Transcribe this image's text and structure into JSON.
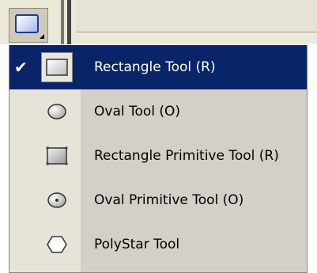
{
  "toolbar": {
    "active_tool_icon": "rectangle-tool-icon"
  },
  "menu": {
    "items": [
      {
        "label": "Rectangle Tool (R)",
        "icon": "rectangle-icon",
        "checked": true
      },
      {
        "label": "Oval Tool (O)",
        "icon": "oval-icon",
        "checked": false
      },
      {
        "label": "Rectangle Primitive Tool (R)",
        "icon": "rectangle-primitive-icon",
        "checked": false
      },
      {
        "label": "Oval Primitive Tool (O)",
        "icon": "oval-primitive-icon",
        "checked": false
      },
      {
        "label": "PolyStar Tool",
        "icon": "polystar-icon",
        "checked": false
      }
    ],
    "check_glyph": "✔"
  },
  "colors": {
    "selection": "#0a246a",
    "menu_bg": "#d4d0c8",
    "gutter_bg": "#e6e3d9"
  }
}
